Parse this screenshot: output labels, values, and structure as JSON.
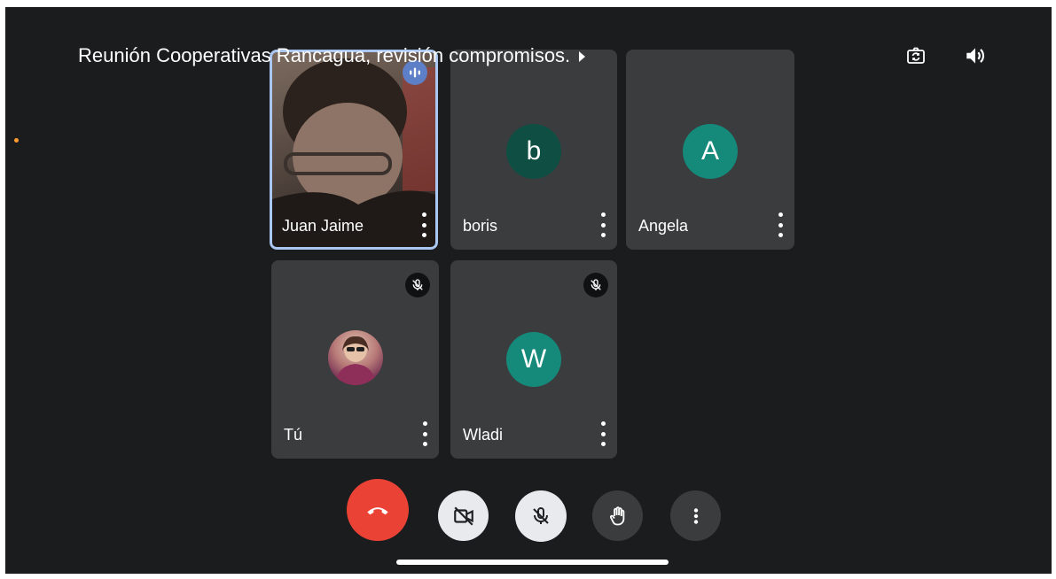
{
  "meeting": {
    "title": "Reunión Cooperativas Rancagua, revisión compromisos."
  },
  "participants": [
    {
      "name": "Juan Jaime",
      "avatar_letter": "",
      "muted": false,
      "speaking": true,
      "video_on": true
    },
    {
      "name": "boris",
      "avatar_letter": "b",
      "muted": false,
      "speaking": false,
      "video_on": false
    },
    {
      "name": "Angela",
      "avatar_letter": "A",
      "muted": false,
      "speaking": false,
      "video_on": false
    },
    {
      "name": "Tú",
      "avatar_letter": "",
      "muted": true,
      "speaking": false,
      "video_on": false
    },
    {
      "name": "Wladi",
      "avatar_letter": "W",
      "muted": true,
      "speaking": false,
      "video_on": false
    }
  ],
  "top_bar": {
    "icons": [
      "camera-switch-icon",
      "speaker-icon"
    ]
  },
  "controls": {
    "icons": [
      "end-call-icon",
      "camera-off-icon",
      "mic-off-icon",
      "raise-hand-icon",
      "more-options-icon"
    ]
  },
  "colors": {
    "background": "#1b1c1e",
    "tile": "#3b3c3e",
    "end_call": "#ea4335",
    "active_speaker_border": "#a9c7f2",
    "avatar_dark_teal": "#0f4f43",
    "avatar_teal": "#15897a"
  }
}
